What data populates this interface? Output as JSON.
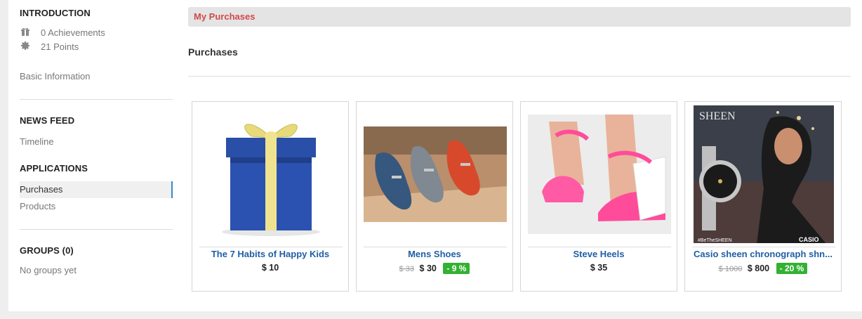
{
  "sidebar": {
    "introduction": {
      "title": "INTRODUCTION",
      "achievements": "0 Achievements",
      "points": "21 Points",
      "basic_info": "Basic Information"
    },
    "news_feed": {
      "title": "NEWS FEED",
      "timeline": "Timeline"
    },
    "applications": {
      "title": "APPLICATIONS",
      "items": [
        {
          "label": "Purchases",
          "active": true
        },
        {
          "label": "Products",
          "active": false
        }
      ]
    },
    "groups": {
      "title": "GROUPS (0)",
      "empty": "No groups yet"
    }
  },
  "main": {
    "breadcrumb": "My Purchases",
    "title": "Purchases",
    "products": [
      {
        "name": "The 7 Habits of Happy Kids",
        "old_price": "",
        "price": "$ 10",
        "discount": "",
        "image": "gift-box-icon"
      },
      {
        "name": "Mens Shoes",
        "old_price": "$ 33",
        "price": "$ 30",
        "discount": "- 9 %",
        "image": "shoes-photo"
      },
      {
        "name": "Steve Heels",
        "old_price": "",
        "price": "$ 35",
        "discount": "",
        "image": "heels-photo"
      },
      {
        "name": "Casio sheen chronograph shn...",
        "old_price": "$ 1000",
        "price": "$ 800",
        "discount": "- 20 %",
        "image": "watch-ad-photo"
      }
    ]
  },
  "colors": {
    "accent": "#d2494a",
    "link": "#1f5fa5",
    "discount": "#33b133",
    "active_border": "#3a87c8"
  }
}
